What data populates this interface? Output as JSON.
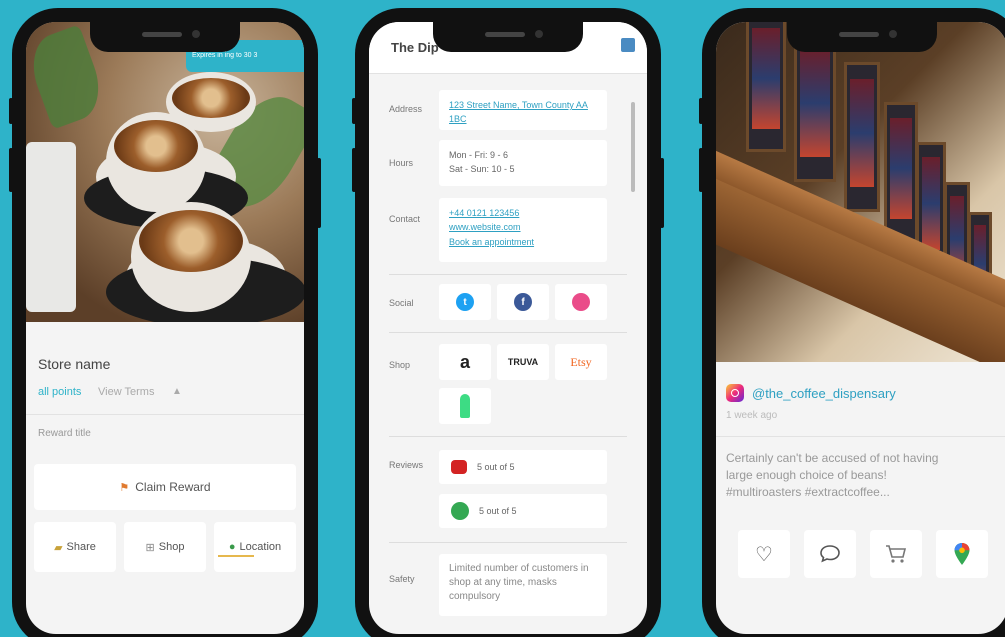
{
  "phone1": {
    "banner": "Expires in ing to 30 3",
    "store_name": "Store name",
    "points": "all points",
    "terms": "View Terms",
    "terms_icon": "▲",
    "reward_title": "Reward title",
    "claim_label": "Claim Reward",
    "actions": [
      {
        "label": "Share",
        "icon": "share-icon"
      },
      {
        "label": "Shop",
        "icon": "shop-icon"
      },
      {
        "label": "Location",
        "icon": "location-pin-icon"
      }
    ]
  },
  "phone2": {
    "title": "The Dip",
    "address_label": "Address",
    "address_value": "123 Street Name, Town County AA 1BC",
    "hours_label": "Hours",
    "hours": [
      "Mon - Fri: 9 - 6",
      "Sat - Sun: 10 - 5"
    ],
    "contact_label": "Contact",
    "contact": [
      "+44 0121 123456",
      "www.website.com",
      "Book an appointment"
    ],
    "social_label": "Social",
    "shop_label": "Shop",
    "shop_items": [
      "a",
      "TRUVA",
      "Etsy"
    ],
    "reviews_label": "Reviews",
    "reviews": [
      "5 out of 5",
      "5 out of 5"
    ],
    "safety_label": "Safety",
    "safety_text": "Limited number of customers in shop at any time, masks compulsory"
  },
  "phone3": {
    "username": "@the_coffee_dispensary",
    "date": "1 week ago",
    "caption": [
      "Certainly can't be accused of not having",
      "large enough choice of beans!",
      "#multiroasters #extractcoffee..."
    ]
  },
  "colors": {
    "background": "#2eb3c9",
    "accent": "#2eb3c9",
    "link": "#2ea0c2"
  }
}
